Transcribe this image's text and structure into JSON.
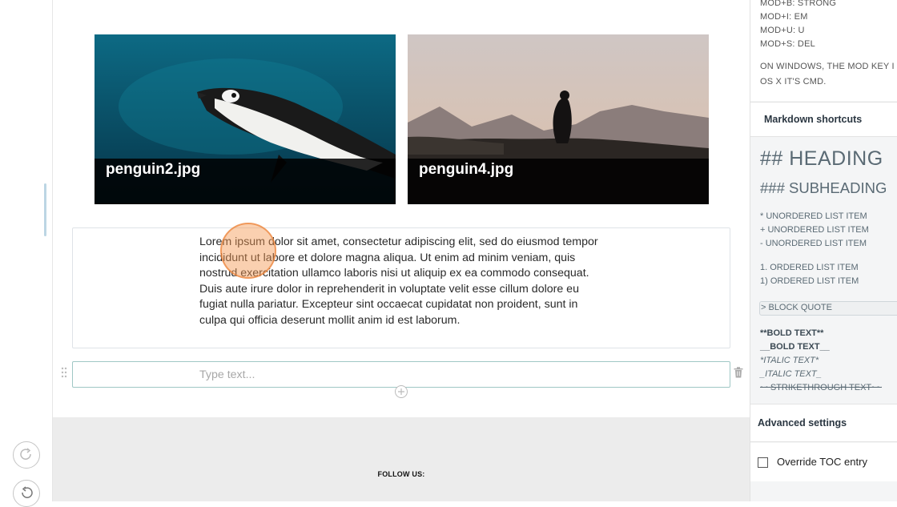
{
  "images": [
    {
      "caption": "penguin2.jpg"
    },
    {
      "caption": "penguin4.jpg"
    }
  ],
  "editor": {
    "paragraph": "Lorem ipsum dolor sit amet, consectetur adipiscing elit, sed do eiusmod tempor incididunt ut labore et dolore magna aliqua. Ut enim ad minim veniam, quis nostrud exercitation ullamco laboris nisi ut aliquip ex ea commodo consequat. Duis aute irure dolor in reprehenderit in voluptate velit esse cillum dolore eu fugiat nulla pariatur. Excepteur sint occaecat cupidatat non proident, sunt in culpa qui officia deserunt mollit anim id est laborum.",
    "input_placeholder": "Type text...",
    "input_value": ""
  },
  "footer": {
    "follow_label": "FOLLOW US:"
  },
  "sidebar": {
    "hotkeys": [
      "MOD+B: STRONG",
      "MOD+I: EM",
      "MOD+U: U",
      "MOD+S: DEL"
    ],
    "mod_note_1": "ON WINDOWS, THE MOD KEY I",
    "mod_note_2": "OS X IT'S CMD.",
    "markdown_title": "Markdown shortcuts",
    "heading": "## HEADING",
    "subheading": "### SUBHEADING",
    "unordered": [
      "* UNORDERED LIST ITEM",
      "+ UNORDERED LIST ITEM",
      "- UNORDERED LIST ITEM"
    ],
    "ordered": [
      "1. ORDERED LIST ITEM",
      "1) ORDERED LIST ITEM"
    ],
    "block_quote": "> BLOCK QUOTE",
    "bold_1": "**BOLD TEXT**",
    "bold_2": "__BOLD TEXT__",
    "italic_1": "*ITALIC TEXT*",
    "italic_2": "_ITALIC TEXT_",
    "strike": "~~STRIKETHROUGH TEXT~~",
    "advanced_title": "Advanced settings",
    "override_label": "Override TOC entry"
  },
  "colors": {
    "accent_border": "#9fc7c5",
    "caption_bg": "#000000",
    "footer_bg": "#ececec"
  }
}
